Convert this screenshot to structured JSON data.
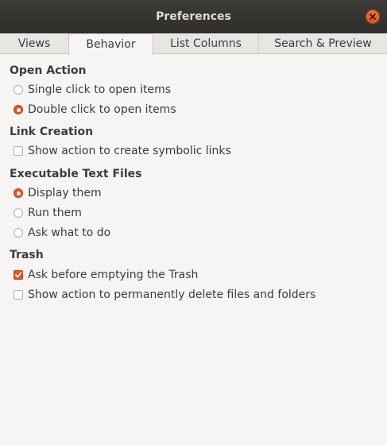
{
  "window": {
    "title": "Preferences"
  },
  "tabs": [
    {
      "label": "Views",
      "active": false
    },
    {
      "label": "Behavior",
      "active": true
    },
    {
      "label": "List Columns",
      "active": false
    },
    {
      "label": "Search & Preview",
      "active": false
    }
  ],
  "open_action": {
    "heading": "Open Action",
    "options": [
      {
        "label": "Single click to open items",
        "selected": false
      },
      {
        "label": "Double click to open items",
        "selected": true
      }
    ]
  },
  "link_creation": {
    "heading": "Link Creation",
    "options": [
      {
        "label": "Show action to create symbolic links",
        "checked": false
      }
    ]
  },
  "executable_text_files": {
    "heading": "Executable Text Files",
    "options": [
      {
        "label": "Display them",
        "selected": true
      },
      {
        "label": "Run them",
        "selected": false
      },
      {
        "label": "Ask what to do",
        "selected": false
      }
    ]
  },
  "trash": {
    "heading": "Trash",
    "options": [
      {
        "label": "Ask before emptying the Trash",
        "checked": true
      },
      {
        "label": "Show action to permanently delete files and folders",
        "checked": false
      }
    ]
  },
  "colors": {
    "accent": "#e95420",
    "titlebar": "#3c3b37",
    "background": "#f6f5f4"
  }
}
